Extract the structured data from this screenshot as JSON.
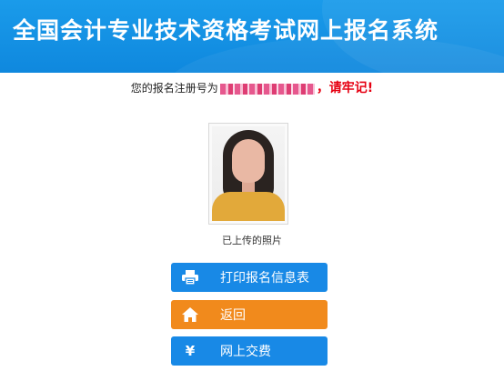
{
  "header": {
    "title": "全国会计专业技术资格考试网上报名系统"
  },
  "registration": {
    "prefix": "您的报名注册号为",
    "warning": "，请牢记!"
  },
  "photo": {
    "caption": "已上传的照片"
  },
  "buttons": {
    "print": {
      "label": "打印报名信息表",
      "icon": "printer-icon"
    },
    "back": {
      "label": "返回",
      "icon": "home-icon"
    },
    "pay": {
      "label": "网上交费",
      "icon": "yen-icon",
      "glyph": "¥"
    }
  },
  "colors": {
    "header_blue": "#1a9bea",
    "button_blue": "#1889e6",
    "button_orange": "#f18a1c",
    "warning_red": "#e60012"
  }
}
